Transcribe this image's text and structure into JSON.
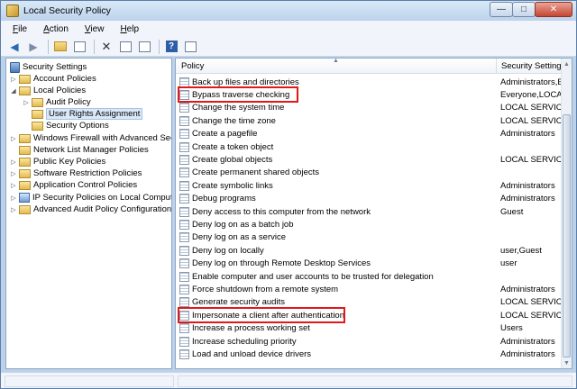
{
  "window": {
    "title": "Local Security Policy",
    "minimize_glyph": "—",
    "maximize_glyph": "□",
    "close_glyph": "✕"
  },
  "menu": [
    {
      "key": "F",
      "rest": "ile"
    },
    {
      "key": "A",
      "rest": "ction"
    },
    {
      "key": "V",
      "rest": "iew"
    },
    {
      "key": "H",
      "rest": "elp"
    }
  ],
  "toolbar": {
    "icons": [
      "back-arrow-icon",
      "forward-arrow-icon",
      "up-folder-icon",
      "show-hide-tree-icon",
      "delete-icon",
      "properties-icon",
      "export-list-icon",
      "help-icon",
      "show-pane-icon"
    ]
  },
  "tree": {
    "root": "Security Settings",
    "items": [
      {
        "label": "Account Policies",
        "expander": "▷",
        "icon": "folder-icon"
      },
      {
        "label": "Local Policies",
        "expander": "◢",
        "icon": "folder-icon"
      },
      {
        "label": "Audit Policy",
        "expander": "▷",
        "icon": "folder-icon"
      },
      {
        "label": "User Rights Assignment",
        "expander": "",
        "icon": "folder-icon",
        "selected": true
      },
      {
        "label": "Security Options",
        "expander": "",
        "icon": "folder-icon"
      },
      {
        "label": "Windows Firewall with Advanced Secu",
        "expander": "▷",
        "icon": "folder-icon"
      },
      {
        "label": "Network List Manager Policies",
        "expander": "",
        "icon": "folder-icon"
      },
      {
        "label": "Public Key Policies",
        "expander": "▷",
        "icon": "folder-icon"
      },
      {
        "label": "Software Restriction Policies",
        "expander": "▷",
        "icon": "folder-icon"
      },
      {
        "label": "Application Control Policies",
        "expander": "▷",
        "icon": "folder-icon"
      },
      {
        "label": "IP Security Policies on Local Compute",
        "expander": "▷",
        "icon": "network-policy-icon"
      },
      {
        "label": "Advanced Audit Policy Configuration",
        "expander": "▷",
        "icon": "folder-icon"
      }
    ]
  },
  "list": {
    "columns": {
      "policy": "Policy",
      "setting": "Security Setting"
    },
    "rows": [
      {
        "policy": "Back up files and directories",
        "setting": "Administrators,B"
      },
      {
        "policy": "Bypass traverse checking",
        "setting": "Everyone,LOCAL",
        "highlighted": true
      },
      {
        "policy": "Change the system time",
        "setting": "LOCAL SERVICE,"
      },
      {
        "policy": "Change the time zone",
        "setting": "LOCAL SERVICE,"
      },
      {
        "policy": "Create a pagefile",
        "setting": "Administrators"
      },
      {
        "policy": "Create a token object",
        "setting": ""
      },
      {
        "policy": "Create global objects",
        "setting": "LOCAL SERVICE,"
      },
      {
        "policy": "Create permanent shared objects",
        "setting": ""
      },
      {
        "policy": "Create symbolic links",
        "setting": "Administrators"
      },
      {
        "policy": "Debug programs",
        "setting": "Administrators"
      },
      {
        "policy": "Deny access to this computer from the network",
        "setting": "Guest"
      },
      {
        "policy": "Deny log on as a batch job",
        "setting": ""
      },
      {
        "policy": "Deny log on as a service",
        "setting": ""
      },
      {
        "policy": "Deny log on locally",
        "setting": "user,Guest"
      },
      {
        "policy": "Deny log on through Remote Desktop Services",
        "setting": "user"
      },
      {
        "policy": "Enable computer and user accounts to be trusted for delegation",
        "setting": ""
      },
      {
        "policy": "Force shutdown from a remote system",
        "setting": "Administrators"
      },
      {
        "policy": "Generate security audits",
        "setting": "LOCAL SERVICE,"
      },
      {
        "policy": "Impersonate a client after authentication",
        "setting": "LOCAL SERVICE,",
        "highlighted": true
      },
      {
        "policy": "Increase a process working set",
        "setting": "Users"
      },
      {
        "policy": "Increase scheduling priority",
        "setting": "Administrators"
      },
      {
        "policy": "Load and unload device drivers",
        "setting": "Administrators"
      }
    ]
  },
  "colors": {
    "highlight_box": "#e01919",
    "selection": "#dbe8f7"
  }
}
